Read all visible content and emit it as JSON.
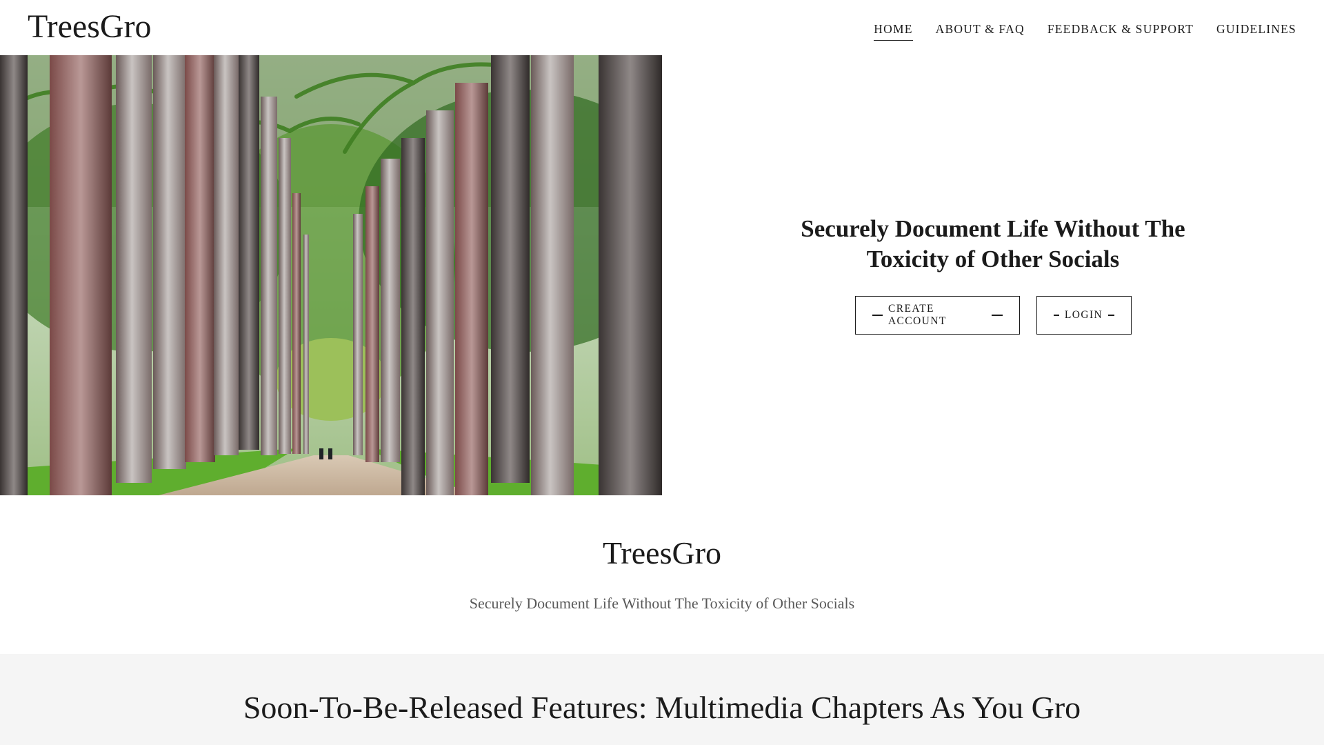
{
  "header": {
    "logo": "TreesGro",
    "nav": [
      {
        "label": "HOME",
        "active": true
      },
      {
        "label": "ABOUT & FAQ",
        "active": false
      },
      {
        "label": "FEEDBACK & SUPPORT",
        "active": false
      },
      {
        "label": "GUIDELINES",
        "active": false
      }
    ]
  },
  "hero": {
    "image": "palm-tree-avenue-photo",
    "title": "Securely Document Life Without The Toxicity of Other Socials",
    "buttons": {
      "create_account": "CREATE ACCOUNT",
      "login": "LOGIN"
    }
  },
  "site_section": {
    "name": "TreesGro",
    "tagline": "Securely Document Life Without The Toxicity of Other Socials"
  },
  "features_section": {
    "title": "Soon-To-Be-Released Features: Multimedia Chapters As You Gro"
  },
  "colors": {
    "text": "#1b1b1b",
    "muted_text": "#595959",
    "section_bg": "#f5f5f5",
    "foliage": "#4f8a2a",
    "path": "#c7b49c"
  }
}
